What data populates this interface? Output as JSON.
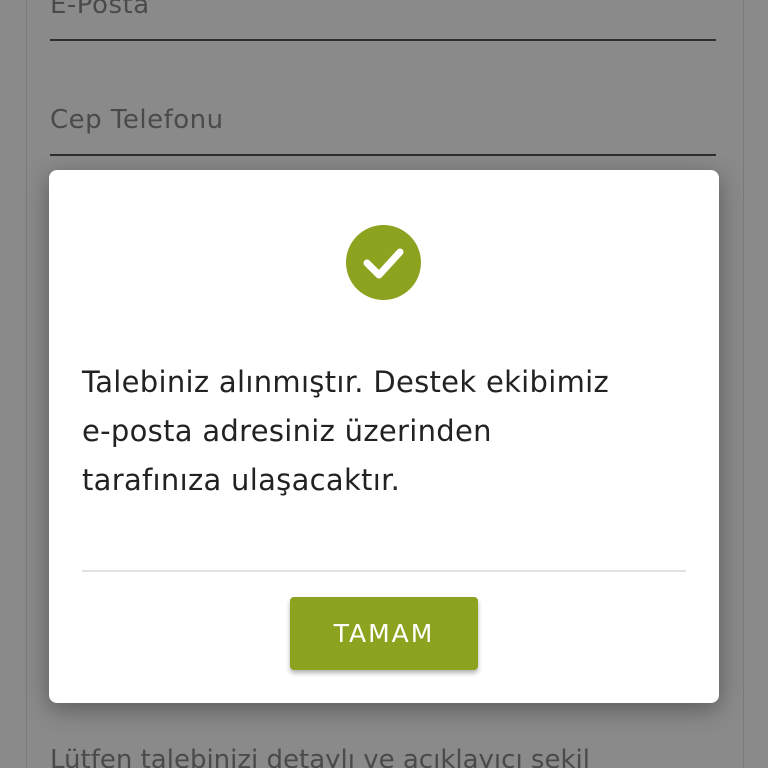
{
  "form": {
    "email_label": "E-Posta",
    "phone_label": "Cep Telefonu",
    "bottom_hint": "Lütfen talebinizi detaylı ve açıklayıcı şekil"
  },
  "dialog": {
    "icon": "check-circle-icon",
    "message_lines": [
      "Talebiniz alınmıştır. Destek ekibimiz",
      "e-posta adresiniz üzerinden",
      "tarafınıza ulaşacaktır."
    ],
    "ok_label": "TAMAM"
  },
  "colors": {
    "accent": "#8ca320",
    "overlay": "rgba(0,0,0,0.46)",
    "text": "#222222"
  }
}
